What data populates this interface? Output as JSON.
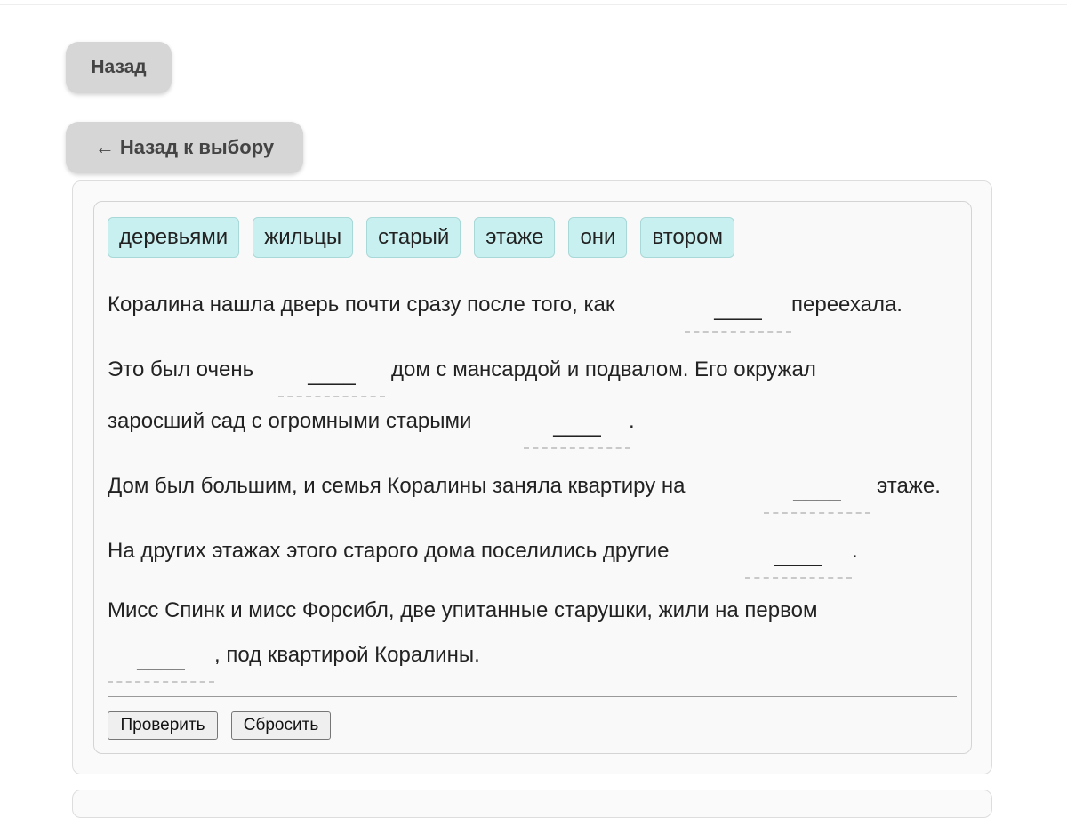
{
  "nav": {
    "back_label": "Назад",
    "back_to_choice_arrow": "←",
    "back_to_choice_label": "Назад к выбору"
  },
  "word_bank": [
    "деревьями",
    "жильцы",
    "старый",
    "этаже",
    "они",
    "втором"
  ],
  "sentences": {
    "s1": {
      "before": "Коралина нашла дверь почти сразу после того, как",
      "blank": "____",
      "after": "переехала."
    },
    "s2": {
      "before": "Это был очень",
      "blank": "____",
      "after": "дом с мансардой и подвалом. Его окружал"
    },
    "s3": {
      "before": "заросший сад с огромными старыми",
      "blank": "____",
      "after": "."
    },
    "s4": {
      "before": "Дом был большим, и семья Коралины заняла квартиру на",
      "blank": "____",
      "after": "этаже."
    },
    "s5": {
      "before": "На других этажах этого старого дома поселились другие",
      "blank": "____",
      "after": "."
    },
    "s6": {
      "before": "Мисс Спинк и мисс Форсибл, две упитанные старушки, жили на первом",
      "blank": "____",
      "after": ", под квартирой Коралины."
    }
  },
  "actions": {
    "check_label": "Проверить",
    "reset_label": "Сбросить"
  },
  "colors": {
    "chip_bg": "#c9f0f0",
    "nav_button_bg": "#d6d6d6"
  }
}
